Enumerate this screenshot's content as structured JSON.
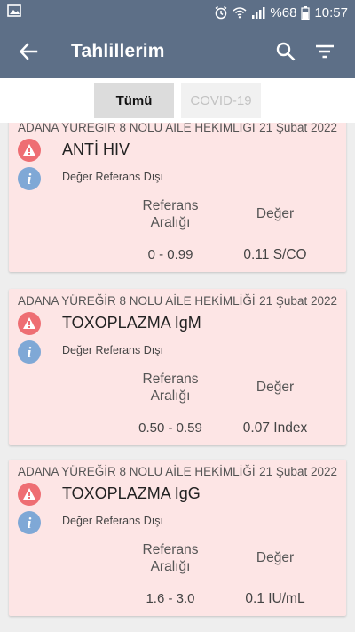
{
  "status_bar": {
    "battery": "%68",
    "time": "10:57",
    "icons": [
      "image-icon",
      "alarm-icon",
      "wifi-icon",
      "signal-icon",
      "battery-icon"
    ]
  },
  "app_bar": {
    "title": "Tahlillerim",
    "icons": [
      "back-arrow-icon",
      "search-icon",
      "filter-icon"
    ]
  },
  "filters": {
    "all": "Tümü",
    "covid": "COVID-19"
  },
  "column_labels": {
    "reference": "Referans Aralığı",
    "value": "Değer"
  },
  "results": [
    {
      "institution": "ADANA YÜREĞİR 8 NOLU AİLE HEKİMLİĞİ",
      "date": "21 Şubat 2022",
      "test_name": "ANTİ HIV",
      "status": "Değer Referans Dışı",
      "reference": "0 - 0.99",
      "value": "0.11 S/CO"
    },
    {
      "institution": "ADANA YÜREĞİR 8 NOLU AİLE HEKİMLİĞİ",
      "date": "21 Şubat 2022",
      "test_name": "TOXOPLAZMA IgM",
      "status": "Değer Referans Dışı",
      "reference": "0.50 - 0.59",
      "value": "0.07 Index"
    },
    {
      "institution": "ADANA YÜREĞİR 8 NOLU AİLE HEKİMLİĞİ",
      "date": "21 Şubat 2022",
      "test_name": "TOXOPLAZMA IgG",
      "status": "Değer Referans Dışı",
      "reference": "1.6 - 3.0",
      "value": "0.1 IU/mL"
    }
  ],
  "colors": {
    "app_bar": "#5d6f87",
    "card_background": "#fde5e5",
    "warning": "#ee6e73",
    "info": "#7fa8d6"
  }
}
